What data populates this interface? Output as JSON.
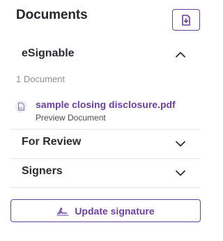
{
  "panel": {
    "title": "Documents",
    "download_icon": "download-document-icon"
  },
  "sections": {
    "esignable": {
      "title": "eSignable",
      "expanded": true,
      "count_label": "1 Document",
      "documents": [
        {
          "name": "sample closing disclosure.pdf",
          "action_label": "Preview Document",
          "icon": "pdf-file-icon"
        }
      ]
    },
    "for_review": {
      "title": "For Review",
      "expanded": false
    },
    "signers": {
      "title": "Signers",
      "expanded": false
    }
  },
  "actions": {
    "update_signature_label": "Update signature",
    "update_signature_icon": "signature-icon"
  },
  "colors": {
    "accent": "#6b3fa0",
    "text": "#2b2b33",
    "muted": "#8f8f99",
    "divider": "#e3e3e8"
  }
}
